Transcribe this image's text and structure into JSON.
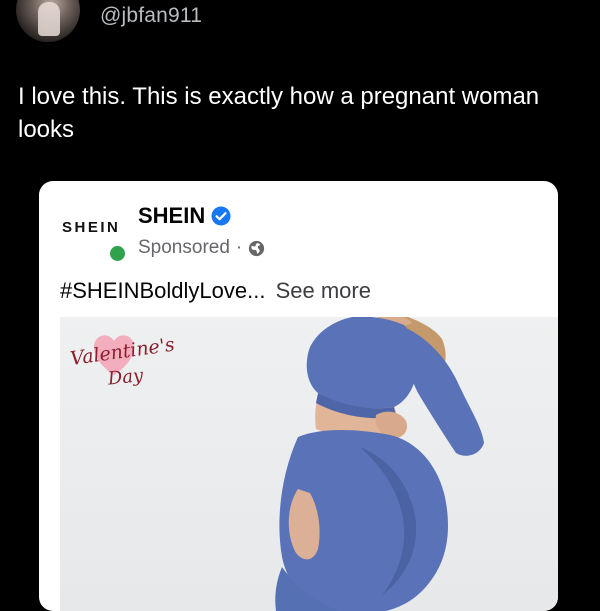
{
  "tweet": {
    "handle": "@jbfan911",
    "text": "I love this. This is exactly how a pregnant woman looks",
    "avatar_icon": "profile-photo"
  },
  "ad": {
    "logo_text": "SHEIN",
    "page_name": "SHEIN",
    "sponsored_label": "Sponsored",
    "separator": "·",
    "caption_hashtag": "#SHEINBoldlyLove...",
    "see_more_label": "See more",
    "badge_line1": "Valentine's",
    "badge_line2": "Day",
    "icons": {
      "verified": "verified-badge-icon",
      "audience": "globe-icon",
      "status": "online-dot"
    },
    "colors": {
      "verified_blue": "#1877f2",
      "online_green": "#31a24c",
      "garment_blue": "#5a72b8",
      "badge_pink": "#f3a6b8"
    }
  }
}
